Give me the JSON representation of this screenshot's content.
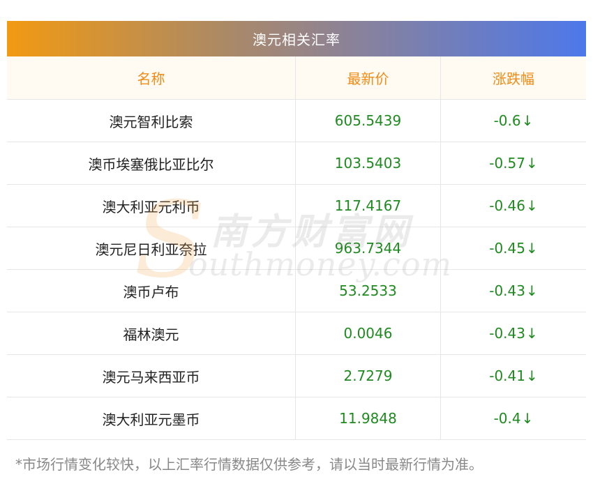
{
  "table": {
    "title": "澳元相关汇率",
    "columns": {
      "name": "名称",
      "price": "最新价",
      "change": "涨跌幅"
    },
    "rows": [
      {
        "name": "澳元智利比索",
        "price": "605.5439",
        "change": "-0.6",
        "arrow": "↓"
      },
      {
        "name": "澳币埃塞俄比亚比尔",
        "price": "103.5403",
        "change": "-0.57",
        "arrow": "↓"
      },
      {
        "name": "澳大利亚元利币",
        "price": "117.4167",
        "change": "-0.46",
        "arrow": "↓"
      },
      {
        "name": "澳元尼日利亚奈拉",
        "price": "963.7344",
        "change": "-0.45",
        "arrow": "↓"
      },
      {
        "name": "澳币卢布",
        "price": "53.2533",
        "change": "-0.43",
        "arrow": "↓"
      },
      {
        "name": "福林澳元",
        "price": "0.0046",
        "change": "-0.43",
        "arrow": "↓"
      },
      {
        "name": "澳元马来西亚币",
        "price": "2.7279",
        "change": "-0.41",
        "arrow": "↓"
      },
      {
        "name": "澳大利亚元墨币",
        "price": "11.9848",
        "change": "-0.4",
        "arrow": "↓"
      }
    ]
  },
  "watermark": {
    "logo_letter": "S",
    "chinese": "南方财富网",
    "english": "outhmoney.com"
  },
  "footnote": "*市场行情变化较快，以上汇率行情数据仅供参考，请以当时最新行情为准。",
  "colors": {
    "header_gradient_start": "#f29a12",
    "header_gradient_end": "#4d78ea",
    "column_header_text": "#f08c16",
    "value_text": "#1f8a1f",
    "name_text": "#222222",
    "footnote_text": "#888888"
  }
}
